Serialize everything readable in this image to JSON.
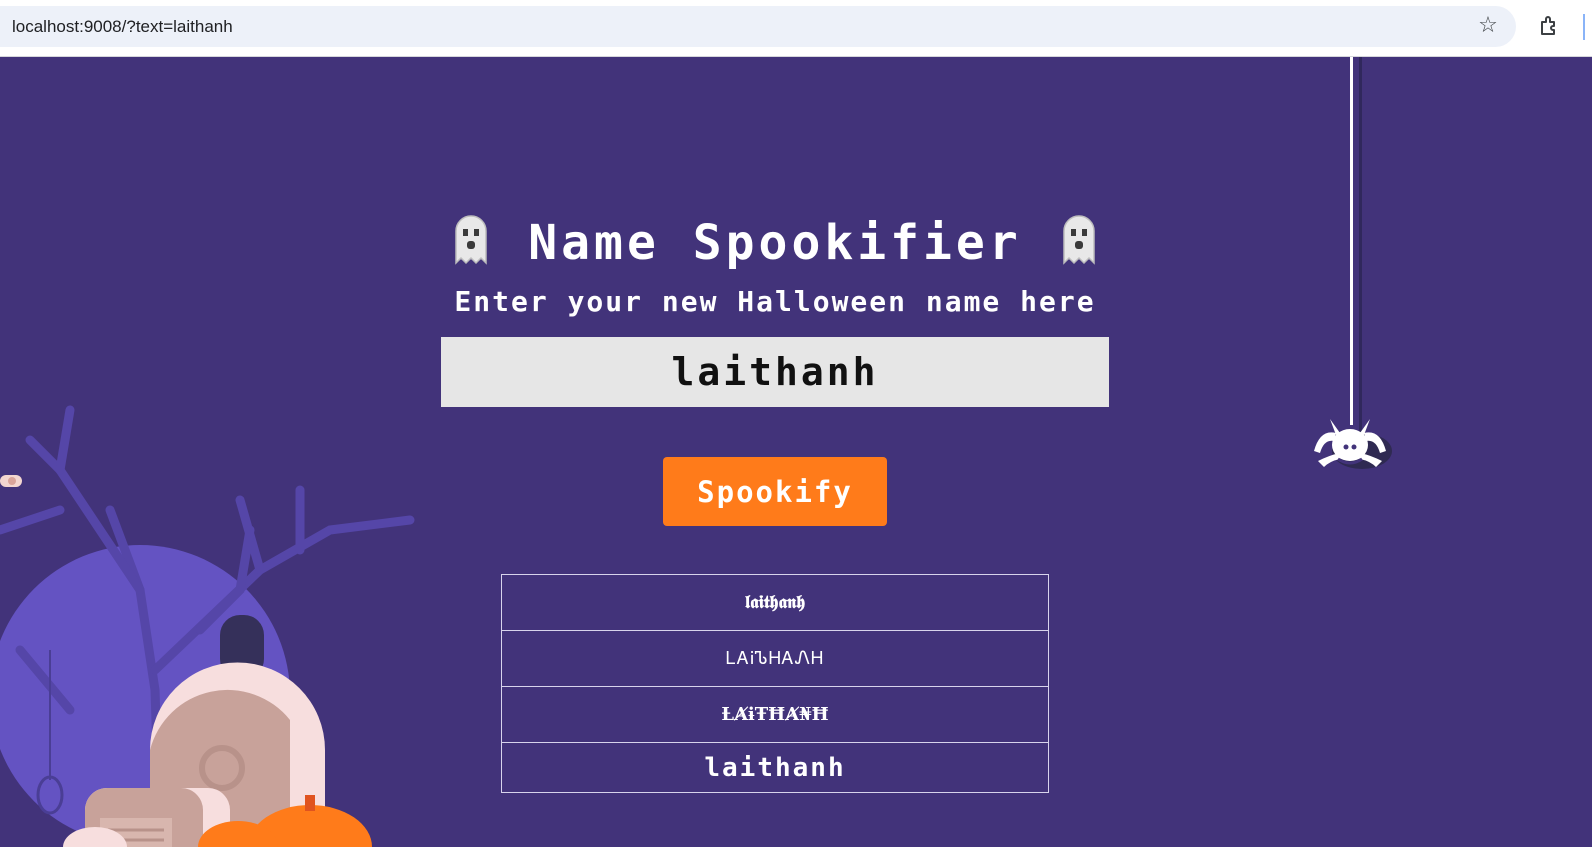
{
  "browser": {
    "url": "localhost:9008/?text=laithanh",
    "icons": [
      "star-icon",
      "extensions-icon"
    ]
  },
  "header": {
    "title": "Name Spookifier",
    "title_icons": [
      "ghost-icon",
      "ghost-icon"
    ],
    "subtitle": "Enter your new Halloween name here"
  },
  "form": {
    "input_value": "laithanh",
    "button_label": "Spookify"
  },
  "results": [
    "𝖑𝖆𝖎𝖙𝖍𝖆𝖓𝖍",
    "ᏞᎪᎥᏖᎻᎪᏁᎻ",
    "ȽȺɨŦĦȺ₦Ħ",
    "laithanh"
  ],
  "colors": {
    "background": "#42337a",
    "button": "#ff7b1a",
    "input_bg": "#e6e6e6"
  }
}
